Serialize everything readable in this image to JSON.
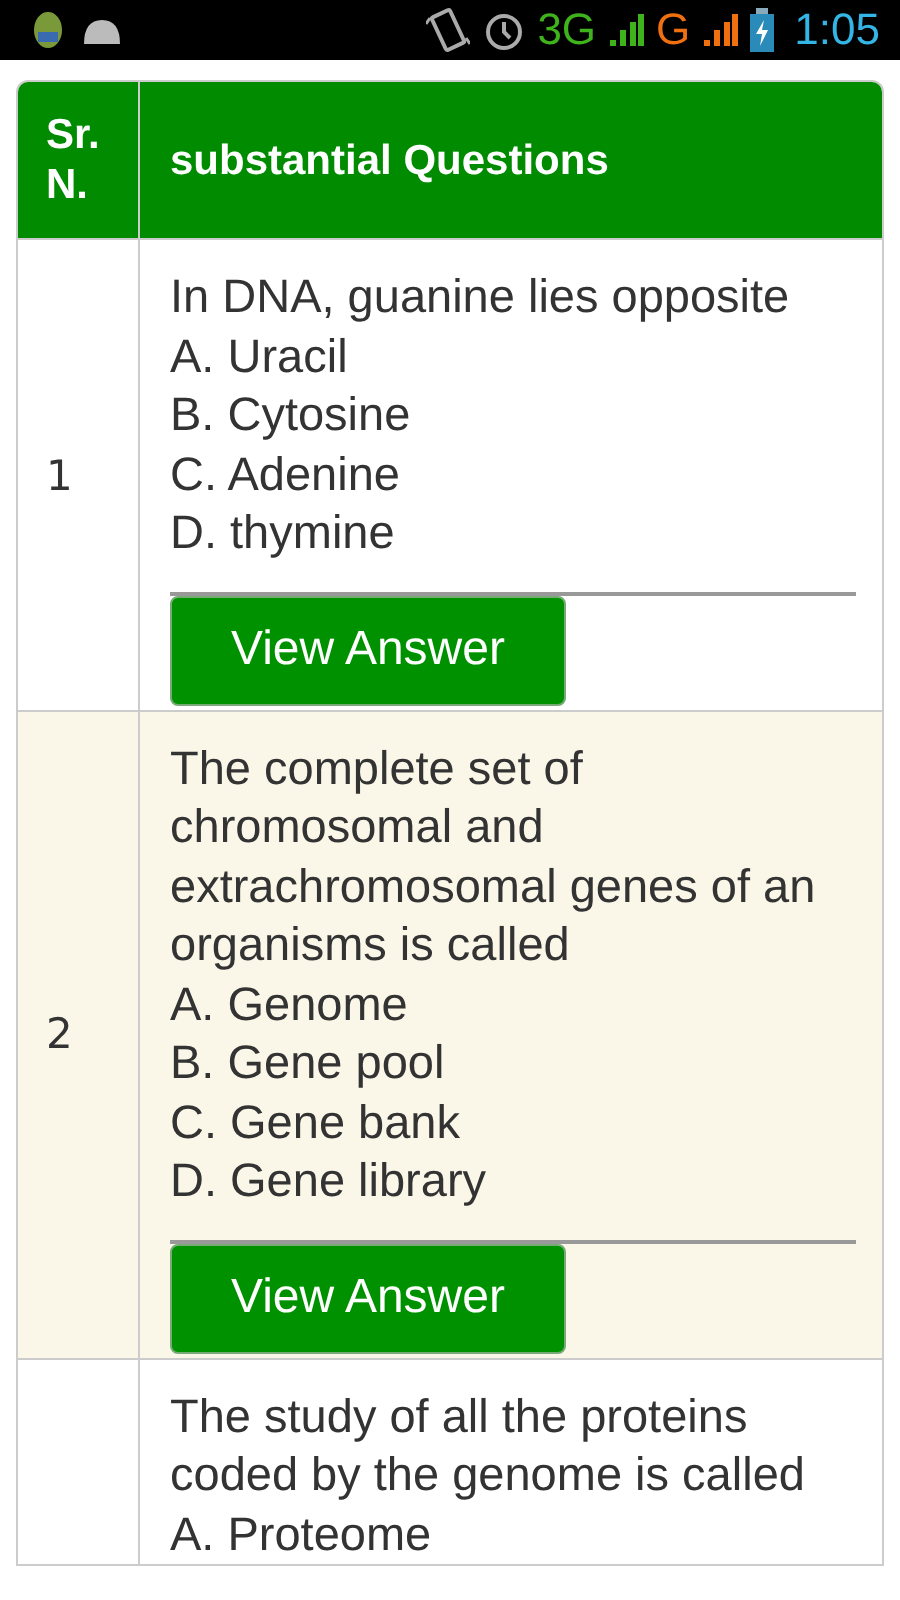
{
  "status_bar": {
    "network_1": "3G",
    "network_2": "G",
    "time": "1:05"
  },
  "table": {
    "columns": [
      "Sr.\nN.",
      "substantial Questions"
    ],
    "rows": [
      {
        "sr": "1",
        "question": "In DNA, guanine lies opposite",
        "options": [
          "A. Uracil",
          "B. Cytosine",
          "C. Adenine",
          "D. thymine"
        ],
        "button": "View Answer"
      },
      {
        "sr": "2",
        "question": "The complete set of chromosomal and extrachromosomal genes of an organisms is called",
        "options": [
          "A. Genome",
          "B. Gene pool",
          "C. Gene bank",
          "D. Gene library"
        ],
        "button": "View Answer"
      },
      {
        "question": "The study of all the proteins coded by the genome is called",
        "options": [
          "A. Proteome"
        ]
      }
    ]
  }
}
